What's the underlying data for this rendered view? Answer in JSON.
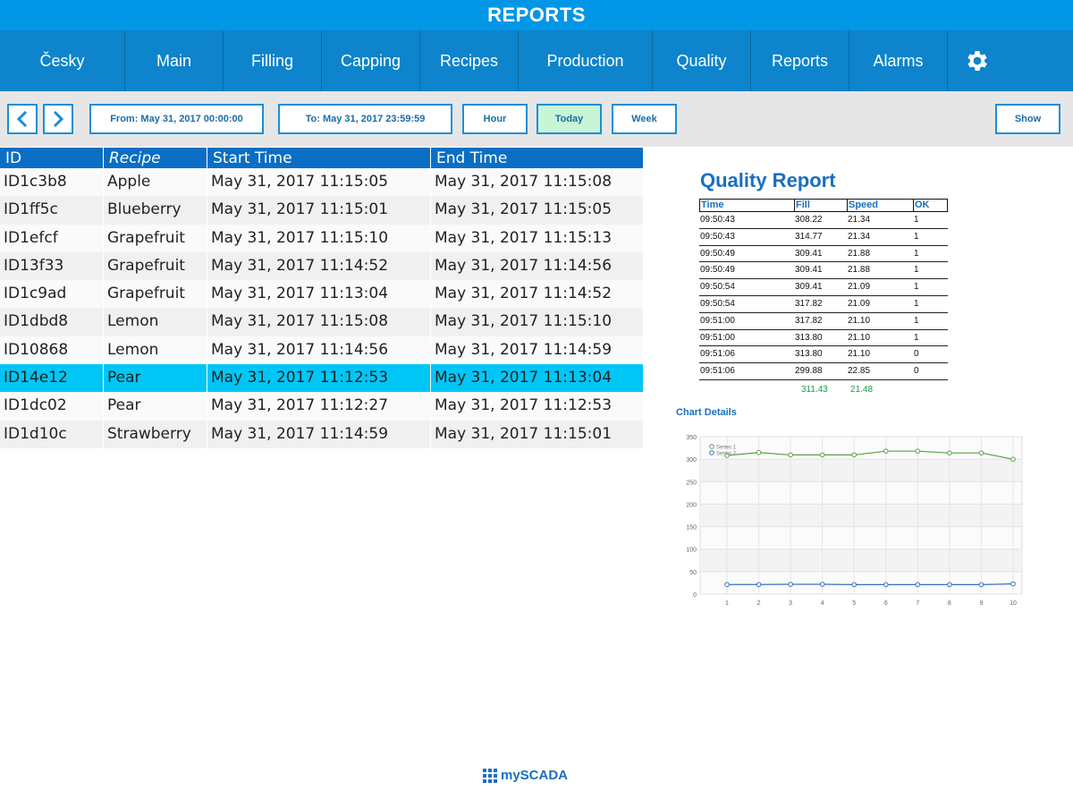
{
  "header": {
    "title": "REPORTS"
  },
  "nav": {
    "items": [
      {
        "label": "Česky",
        "w": 140
      },
      {
        "label": "Main",
        "w": 110
      },
      {
        "label": "Filling",
        "w": 110
      },
      {
        "label": "Capping",
        "w": 110
      },
      {
        "label": "Recipes",
        "w": 110
      },
      {
        "label": "Production",
        "w": 150
      },
      {
        "label": "Quality",
        "w": 110
      },
      {
        "label": "Reports",
        "w": 110
      },
      {
        "label": "Alarms",
        "w": 110
      }
    ],
    "settings_icon": "gear-icon"
  },
  "toolbar": {
    "from_label": "From: May 31, 2017 00:00:00",
    "to_label": "To: May 31, 2017 23:59:59",
    "hour": "Hour",
    "today": "Today",
    "week": "Week",
    "show": "Show",
    "active": "today"
  },
  "table": {
    "headers": [
      "ID",
      "Recipe",
      "Start Time",
      "End Time"
    ],
    "rows": [
      {
        "id": "ID1c3b8",
        "recipe": "Apple",
        "start": "May 31, 2017 11:15:05",
        "end": "May 31, 2017 11:15:08"
      },
      {
        "id": "ID1ff5c",
        "recipe": "Blueberry",
        "start": "May 31, 2017 11:15:01",
        "end": "May 31, 2017 11:15:05"
      },
      {
        "id": "ID1efcf",
        "recipe": "Grapefruit",
        "start": "May 31, 2017 11:15:10",
        "end": "May 31, 2017 11:15:13"
      },
      {
        "id": "ID13f33",
        "recipe": "Grapefruit",
        "start": "May 31, 2017 11:14:52",
        "end": "May 31, 2017 11:14:56"
      },
      {
        "id": "ID1c9ad",
        "recipe": "Grapefruit",
        "start": "May 31, 2017 11:13:04",
        "end": "May 31, 2017 11:14:52"
      },
      {
        "id": "ID1dbd8",
        "recipe": "Lemon",
        "start": "May 31, 2017 11:15:08",
        "end": "May 31, 2017 11:15:10"
      },
      {
        "id": "ID10868",
        "recipe": "Lemon",
        "start": "May 31, 2017 11:14:56",
        "end": "May 31, 2017 11:14:59"
      },
      {
        "id": "ID14e12",
        "recipe": "Pear",
        "start": "May 31, 2017 11:12:53",
        "end": "May 31, 2017 11:13:04",
        "selected": true
      },
      {
        "id": "ID1dc02",
        "recipe": "Pear",
        "start": "May 31, 2017 11:12:27",
        "end": "May 31, 2017 11:12:53"
      },
      {
        "id": "ID1d10c",
        "recipe": "Strawberry",
        "start": "May 31, 2017 11:14:59",
        "end": "May 31, 2017 11:15:01"
      }
    ]
  },
  "quality_report": {
    "title": "Quality Report",
    "headers": [
      "Time",
      "Fill",
      "Speed",
      "OK"
    ],
    "rows": [
      [
        "09:50:43",
        "308.22",
        "21.34",
        "1"
      ],
      [
        "09:50:43",
        "314.77",
        "21.34",
        "1"
      ],
      [
        "09:50:49",
        "309.41",
        "21.88",
        "1"
      ],
      [
        "09:50:49",
        "309.41",
        "21.88",
        "1"
      ],
      [
        "09:50:54",
        "309.41",
        "21.09",
        "1"
      ],
      [
        "09:50:54",
        "317.82",
        "21.09",
        "1"
      ],
      [
        "09:51:00",
        "317.82",
        "21.10",
        "1"
      ],
      [
        "09:51:00",
        "313.80",
        "21.10",
        "1"
      ],
      [
        "09:51:06",
        "313.80",
        "21.10",
        "0"
      ],
      [
        "09:51:06",
        "299.88",
        "22.85",
        "0"
      ]
    ],
    "averages": [
      "",
      "311.43",
      "21.48",
      ""
    ]
  },
  "chart_title": "Chart Details",
  "chart_data": {
    "type": "line",
    "x": [
      1,
      2,
      3,
      4,
      5,
      6,
      7,
      8,
      9,
      10
    ],
    "ylim": [
      0,
      350
    ],
    "yticks": [
      0,
      50,
      100,
      150,
      200,
      250,
      300,
      350
    ],
    "grid": true,
    "legend": "top-left",
    "series": [
      {
        "name": "Series 1",
        "color": "#5aa04a",
        "values": [
          308.22,
          314.77,
          309.41,
          309.41,
          309.41,
          317.82,
          317.82,
          313.8,
          313.8,
          299.88
        ]
      },
      {
        "name": "Series 2",
        "color": "#3a6fc2",
        "values": [
          21.34,
          21.34,
          21.88,
          21.88,
          21.09,
          21.09,
          21.1,
          21.1,
          21.1,
          22.85
        ]
      }
    ]
  },
  "footer": {
    "brand": "mySCADA"
  }
}
